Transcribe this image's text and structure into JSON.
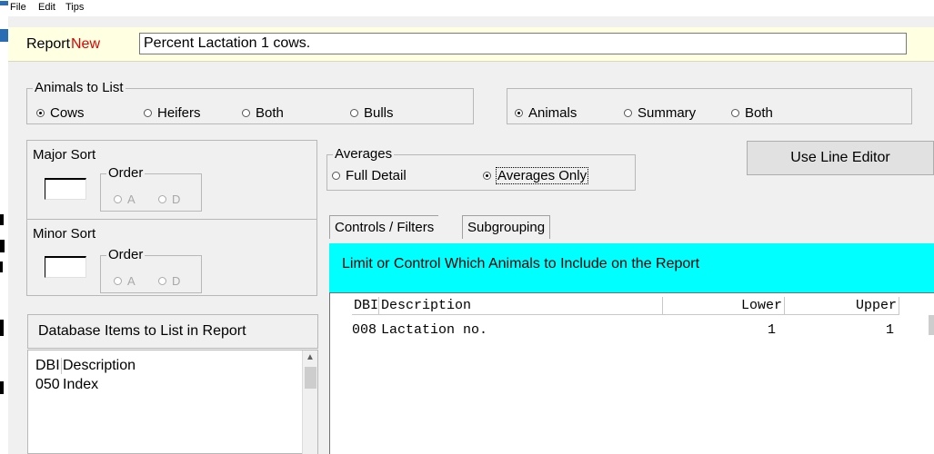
{
  "menu": {
    "file": "File",
    "edit": "Edit",
    "tips": "Tips"
  },
  "report": {
    "label": "Report",
    "status": "New",
    "title_value": "Percent Lactation 1 cows."
  },
  "animals_to_list": {
    "title": "Animals to List",
    "options": [
      "Cows",
      "Heifers",
      "Both",
      "Bulls"
    ],
    "selected": "Cows"
  },
  "output_mode": {
    "options": [
      "Animals",
      "Summary",
      "Both"
    ],
    "selected": "Animals"
  },
  "major_sort": {
    "title": "Major Sort",
    "order_title": "Order",
    "options": [
      "A",
      "D"
    ],
    "value": ""
  },
  "minor_sort": {
    "title": "Minor Sort",
    "order_title": "Order",
    "options": [
      "A",
      "D"
    ],
    "value": ""
  },
  "averages": {
    "title": "Averages",
    "options": [
      "Full Detail",
      "Averages Only"
    ],
    "selected": "Averages Only"
  },
  "line_editor_button": "Use Line Editor",
  "tabs": {
    "controls": "Controls / Filters",
    "subgrouping": "Subgrouping"
  },
  "filters": {
    "banner": "Limit or Control Which Animals to Include on the Report",
    "columns": {
      "dbi": "DBI",
      "description": "Description",
      "lower": "Lower",
      "upper": "Upper"
    },
    "rows": [
      {
        "dbi": "008",
        "description": "Lactation no.",
        "lower": "1",
        "upper": "1"
      }
    ]
  },
  "database_items": {
    "button": "Database Items to List in Report",
    "columns": {
      "dbi": "DBI",
      "description": "Description"
    },
    "rows": [
      {
        "dbi": "050",
        "description": "Index"
      }
    ]
  },
  "colors": {
    "accent_new": "#e00000",
    "banner": "#00ffff",
    "report_bg": "#ffffe1"
  }
}
